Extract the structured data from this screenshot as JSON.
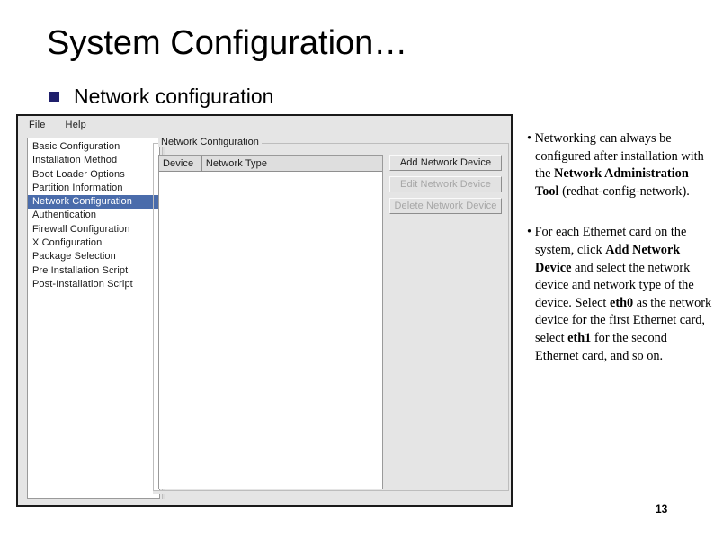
{
  "slide": {
    "title": "System Configuration…",
    "bullet_icon": "square-bullet-icon",
    "bullet_text": "Network configuration",
    "page_number": "13",
    "bullet_color": "#1f1f6b"
  },
  "app_window": {
    "menu": [
      {
        "label": "File",
        "mnemonic": "F",
        "rest": "ile"
      },
      {
        "label": "Help",
        "mnemonic": "H",
        "rest": "elp"
      }
    ],
    "nav_list": [
      {
        "label": "Basic Configuration",
        "selected": false
      },
      {
        "label": "Installation Method",
        "selected": false
      },
      {
        "label": "Boot Loader Options",
        "selected": false
      },
      {
        "label": "Partition Information",
        "selected": false
      },
      {
        "label": "Network Configuration",
        "selected": true
      },
      {
        "label": "Authentication",
        "selected": false
      },
      {
        "label": "Firewall Configuration",
        "selected": false
      },
      {
        "label": "X Configuration",
        "selected": false
      },
      {
        "label": "Package Selection",
        "selected": false
      },
      {
        "label": "Pre Installation Script",
        "selected": false
      },
      {
        "label": "Post-Installation Script",
        "selected": false
      }
    ],
    "selection_color": "#4a6cab",
    "group_box": {
      "legend": "Network Configuration"
    },
    "device_table": {
      "columns": [
        "Device",
        "Network Type"
      ],
      "rows": []
    },
    "buttons": [
      {
        "label": "Add Network Device",
        "enabled": true
      },
      {
        "label": "Edit Network Device",
        "enabled": false
      },
      {
        "label": "Delete Network Device",
        "enabled": false
      }
    ]
  },
  "notes": {
    "paragraph_1": {
      "prefix": "•  Networking can always be configured after installation with the ",
      "bold": "Network Administration Tool",
      "suffix": " (redhat-config-network)."
    },
    "paragraph_2": {
      "prefix": "• For each Ethernet card on the system, click ",
      "bold_1": "Add Network Device",
      "mid_1": " and select the network device and network type of the device. Select ",
      "bold_2": "eth0",
      "mid_2": " as the network device for the first Ethernet card, select ",
      "bold_3": "eth1",
      "suffix": " for the second Ethernet card, and so on."
    }
  }
}
